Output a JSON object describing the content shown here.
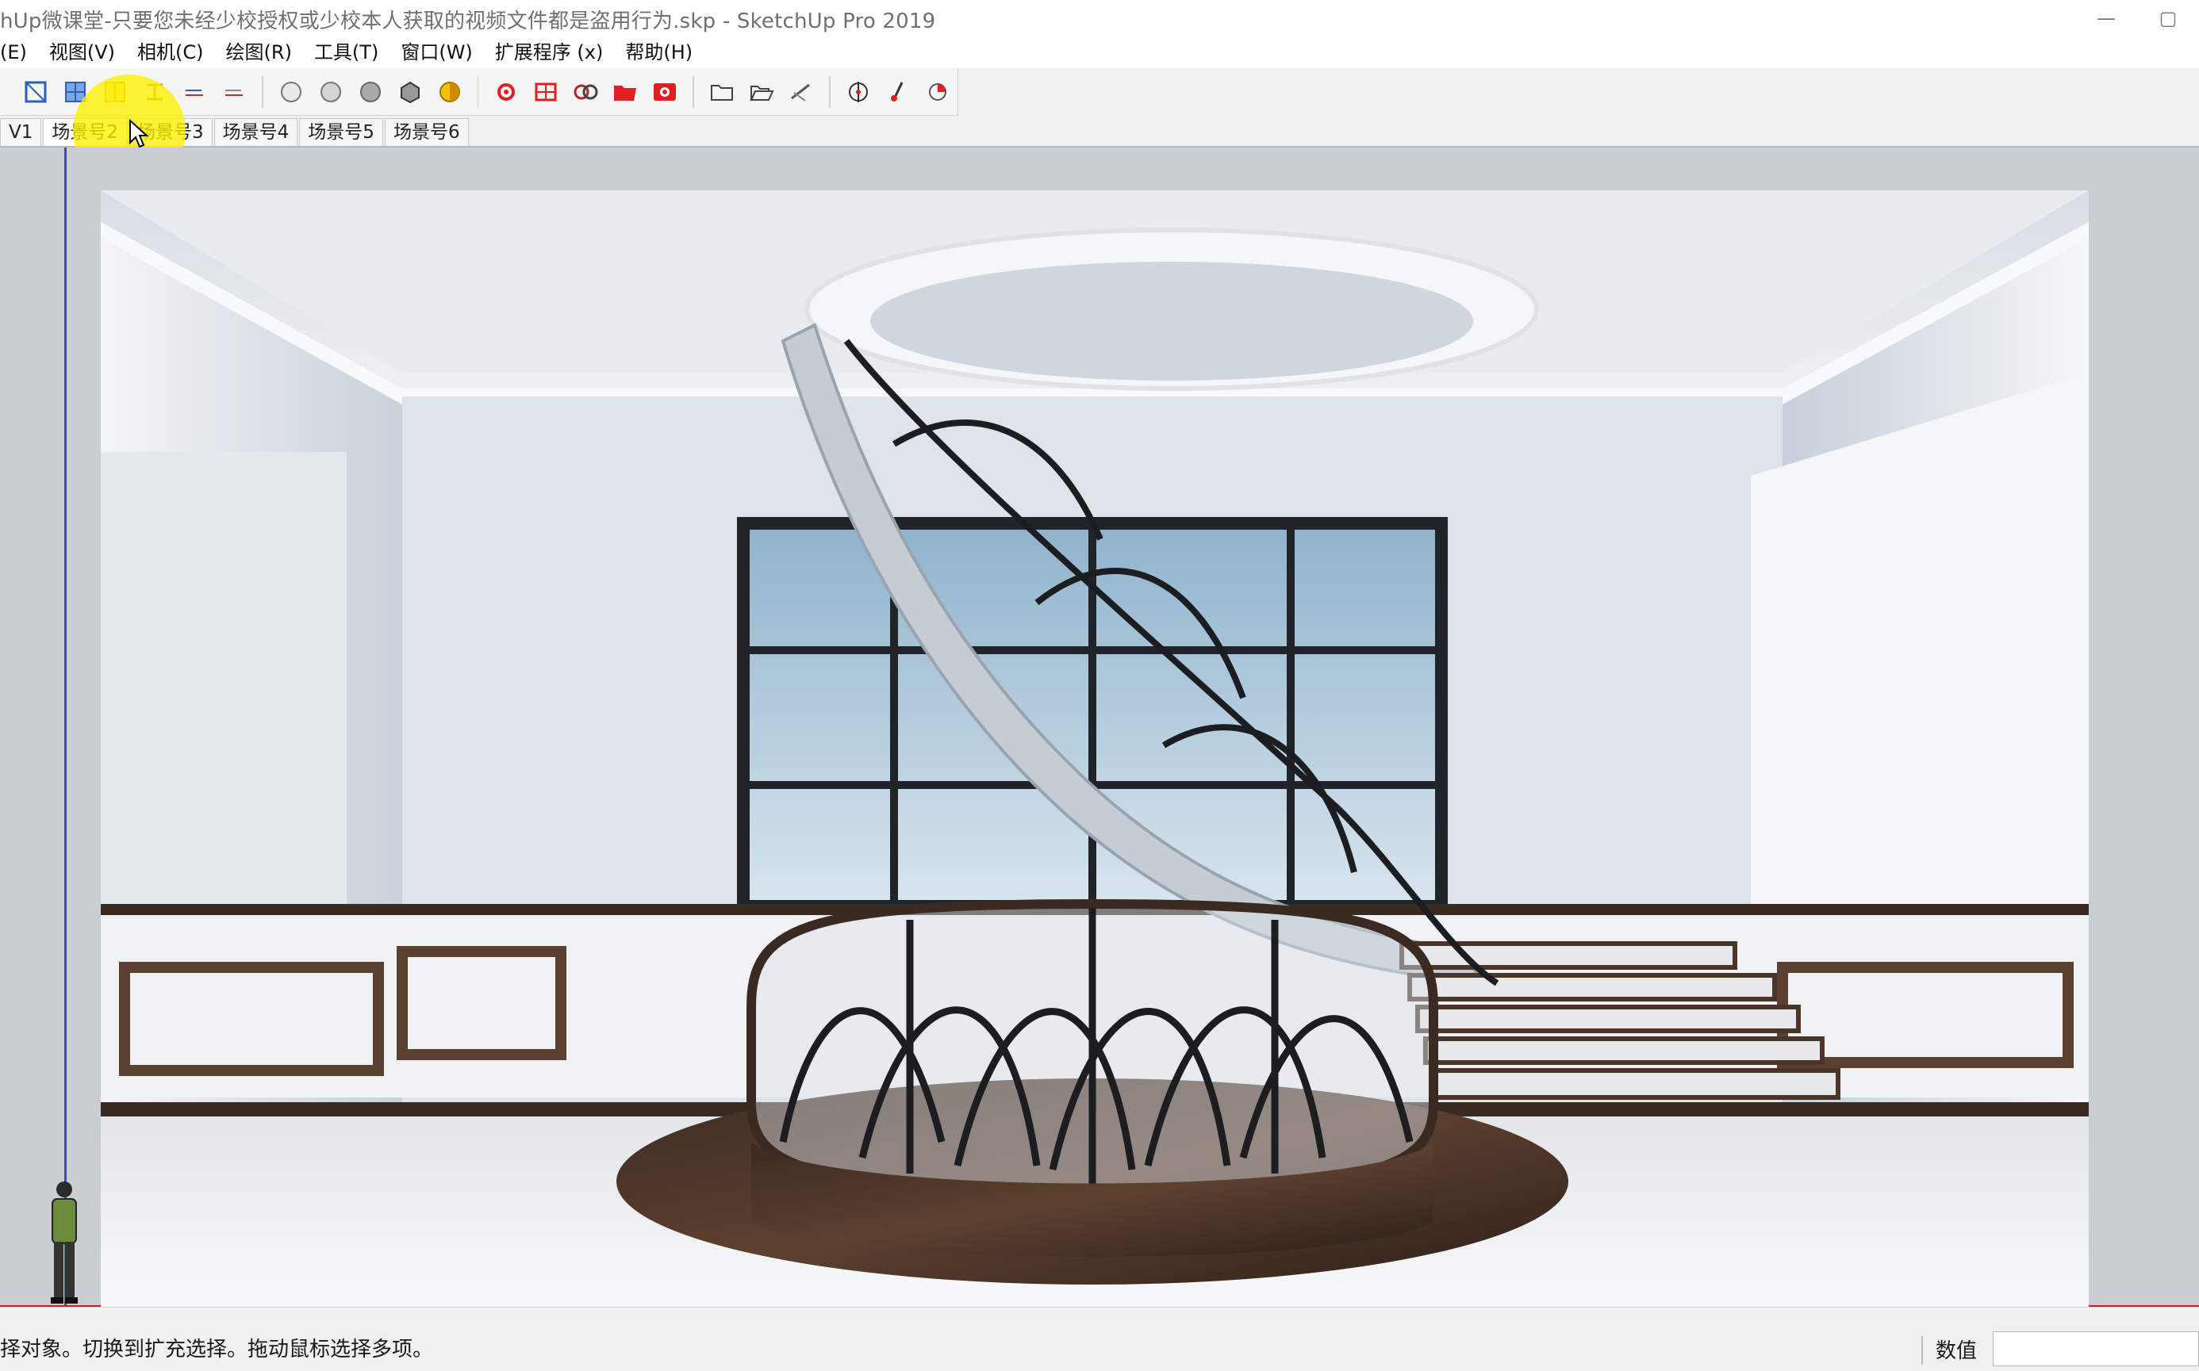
{
  "window": {
    "title": "hUp微课堂-只要您未经少校授权或少校本人获取的视频文件都是盗用行为.skp - SketchUp Pro 2019",
    "controls": [
      "—",
      "▢"
    ]
  },
  "menubar": {
    "items": [
      "编辑(E)",
      "视图(V)",
      "相机(C)",
      "绘图(R)",
      "工具(T)",
      "窗口(W)",
      "扩展程序 (x)",
      "帮助(H)"
    ]
  },
  "menubar_visible": [
    "(E)",
    "视图(V)",
    "相机(C)",
    "绘图(R)",
    "工具(T)",
    "窗口(W)",
    "扩展程序 (x)",
    "帮助(H)"
  ],
  "toolbar": {
    "icons": [
      "section-plane-icon",
      "section-fill-icon",
      "display-section-cuts-icon",
      "align-view-icon",
      "section-down-icon",
      "section-up-icon",
      "xray-icon",
      "back-edges-icon",
      "hidden-line-icon",
      "shaded-icon",
      "textured-icon",
      "render-settings-icon",
      "render-frame-icon",
      "render-camera-icon",
      "render-folder-icon",
      "render-start-icon",
      "open-folder-icon",
      "open-file-icon",
      "sketch-icon",
      "geo-location-icon",
      "brush-icon",
      "shadow-toggle-icon"
    ]
  },
  "scenes": {
    "tabs": [
      "V1",
      "场景号2",
      "场景号3",
      "场景号4",
      "场景号5",
      "场景号6"
    ],
    "active": "场景号2"
  },
  "status": {
    "hint": "选择对象。切换到扩充选择。拖动鼠标选择多项。",
    "hint_visible": "择对象。切换到扩充选择。拖动鼠标选择多项。",
    "measure_label": "数值",
    "measure_value": ""
  },
  "colors": {
    "axis_blue": "#3c48c8",
    "axis_red": "#d02020",
    "highlight": "#fff000"
  }
}
